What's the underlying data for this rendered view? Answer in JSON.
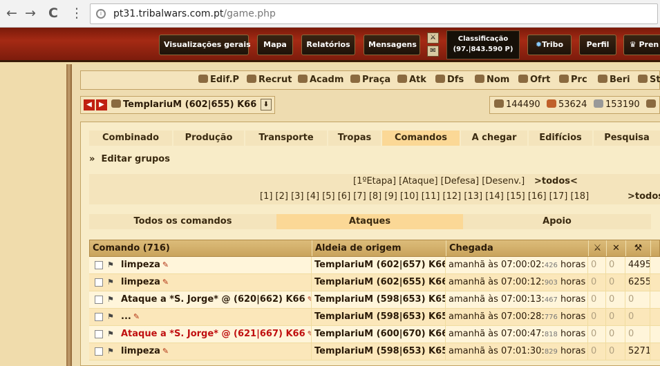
{
  "browser": {
    "back": "←",
    "forward": "→",
    "reload": "C",
    "apps": "⋮",
    "url_host": "pt31.tribalwars.com.pt",
    "url_path": "/game.php"
  },
  "topnav": {
    "items": [
      "Visualizações gerais",
      "Mapa",
      "Relatórios",
      "Mensagens"
    ],
    "rank_label": "Classificação",
    "rank_value": "(97.|843.590 P)",
    "tribe": "Tribo",
    "profile": "Perfil",
    "premium": "Pren"
  },
  "quickbar": [
    "Edif.P",
    "Recrut",
    "Acadm",
    "Praça",
    "Atk",
    "Dfs",
    "Nom",
    "Ofrt",
    "Prc",
    "Beri",
    "St"
  ],
  "village": {
    "name": "TemplariuM",
    "coords": "(602|655) K66"
  },
  "resources": {
    "wood": "144490",
    "clay": "53624",
    "iron": "153190"
  },
  "tabs": [
    "Combinado",
    "Produção",
    "Transporte",
    "Tropas",
    "Comandos",
    "A chegar",
    "Edifícios",
    "Pesquisa"
  ],
  "active_tab": "Comandos",
  "edit_groups": "Editar grupos",
  "groups_line1": "[1ºEtapa] [Ataque] [Defesa] [Desenv.]",
  "groups_line1_all": ">todos<",
  "groups_line2": "[1] [2] [3] [4] [5] [6] [7] [8] [9] [10] [11] [12] [13] [14] [15] [16] [17] [18]",
  "groups_line2_all": ">todos",
  "categories": [
    "Todos os comandos",
    "Ataques",
    "Apoio"
  ],
  "table": {
    "headers": {
      "command": "Comando (716)",
      "origin": "Aldeia de origem",
      "arrival": "Chegada"
    },
    "rows": [
      {
        "command": "limpeza",
        "origin": "TemplariuM (602|657) K66",
        "arrival": "amanhã às 07:00:02:",
        "ms": "426",
        "unit": "horas",
        "u1": "0",
        "u2": "0",
        "u3": "4495",
        "red": false
      },
      {
        "command": "limpeza",
        "origin": "TemplariuM (602|655) K66",
        "arrival": "amanhã às 07:00:12:",
        "ms": "903",
        "unit": "horas",
        "u1": "0",
        "u2": "0",
        "u3": "6255",
        "red": false
      },
      {
        "command": "Ataque a *S. Jorge* @ (620|662) K66",
        "origin": "TemplariuM (598|653) K65",
        "arrival": "amanhã às 07:00:13:",
        "ms": "467",
        "unit": "horas",
        "u1": "0",
        "u2": "0",
        "u3": "0",
        "red": false
      },
      {
        "command": "...",
        "origin": "TemplariuM (598|653) K65",
        "arrival": "amanhã às 07:00:28:",
        "ms": "776",
        "unit": "horas",
        "u1": "0",
        "u2": "0",
        "u3": "0",
        "red": false
      },
      {
        "command": "Ataque a *S. Jorge* @ (621|667) K66",
        "origin": "TemplariuM (600|670) K66",
        "arrival": "amanhã às 07:00:47:",
        "ms": "818",
        "unit": "horas",
        "u1": "0",
        "u2": "0",
        "u3": "0",
        "red": true
      },
      {
        "command": "limpeza",
        "origin": "TemplariuM (598|653) K65",
        "arrival": "amanhã às 07:01:30:",
        "ms": "829",
        "unit": "horas",
        "u1": "0",
        "u2": "0",
        "u3": "5271",
        "red": false
      }
    ]
  }
}
